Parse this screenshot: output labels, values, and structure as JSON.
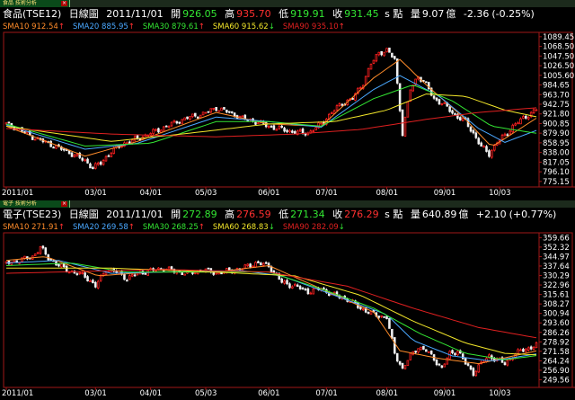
{
  "colors": {
    "up": "#ff2020",
    "down": "#f0f0f0",
    "axis_frame": "#a01818",
    "axis_text": "#ffffff",
    "sma10": "#ff8c2a",
    "sma20": "#4aa8ff",
    "sma30": "#33e633",
    "sma60": "#f2e62a",
    "sma90": "#e02020"
  },
  "panels": [
    {
      "tab_label": "食品 技術分析",
      "info": {
        "name": "食品(TSE12)",
        "period": "日線圖",
        "date": "2011/11/01",
        "open_label": "開",
        "open": "926.05",
        "high_label": "高",
        "high": "935.70",
        "low_label": "低",
        "low": "919.91",
        "close_label": "收",
        "close": "931.45",
        "unit": "s 點",
        "volume_label": "量",
        "volume": "9.07",
        "volume_unit": "億",
        "change": "-2.36",
        "change_pct": "(-0.25%)"
      },
      "ma_legend": [
        {
          "label": "SMA10",
          "value": "912.54",
          "arrow": "↑",
          "color": "#ff8c2a"
        },
        {
          "label": "SMA20",
          "value": "885.95",
          "arrow": "↑",
          "color": "#4aa8ff"
        },
        {
          "label": "SMA30",
          "value": "879.61",
          "arrow": "↑",
          "color": "#33e633"
        },
        {
          "label": "SMA60",
          "value": "915.62",
          "arrow": "↓",
          "color": "#f2e62a"
        },
        {
          "label": "SMA90",
          "value": "935.10",
          "arrow": "↑",
          "color": "#e02020"
        }
      ]
    },
    {
      "tab_label": "電子 技術分析",
      "info": {
        "name": "電子(TSE23)",
        "period": "日線圖",
        "date": "2011/11/01",
        "open_label": "開",
        "open": "272.89",
        "high_label": "高",
        "high": "276.59",
        "low_label": "低",
        "low": "271.34",
        "close_label": "收",
        "close": "276.29",
        "unit": "s 點",
        "volume_label": "量",
        "volume": "640.89",
        "volume_unit": "億",
        "change": "+2.10",
        "change_pct": "(+0.77%)"
      },
      "ma_legend": [
        {
          "label": "SMA10",
          "value": "271.91",
          "arrow": "↑",
          "color": "#ff8c2a"
        },
        {
          "label": "SMA20",
          "value": "269.58",
          "arrow": "↑",
          "color": "#4aa8ff"
        },
        {
          "label": "SMA30",
          "value": "268.25",
          "arrow": "↑",
          "color": "#33e633"
        },
        {
          "label": "SMA60",
          "value": "268.83",
          "arrow": "↓",
          "color": "#f2e62a"
        },
        {
          "label": "SMA90",
          "value": "282.09",
          "arrow": "↓",
          "color": "#e02020"
        }
      ]
    }
  ],
  "chart_data": [
    {
      "type": "candlestick",
      "title": "食品(TSE12) 日線圖",
      "ylim": [
        767,
        1095
      ],
      "y_ticks": [
        "1089.45",
        "1068.50",
        "1047.50",
        "1026.50",
        "1005.60",
        "984.65",
        "963.70",
        "942.75",
        "921.80",
        "900.85",
        "879.90",
        "858.95",
        "838.00",
        "817.05",
        "796.10",
        "775.15"
      ],
      "y_tick_values": [
        1089.45,
        1068.5,
        1047.5,
        1026.5,
        1005.6,
        984.65,
        963.7,
        942.75,
        921.8,
        900.85,
        879.9,
        858.95,
        838.0,
        817.05,
        796.1,
        775.15
      ],
      "x_ticks": [
        "2011/01",
        "03/01",
        "04/01",
        "05/03",
        "06/01",
        "07/01",
        "08/01",
        "09/01",
        "10/03"
      ],
      "x_tick_index": [
        0,
        34,
        55,
        76,
        100,
        122,
        145,
        167,
        188
      ],
      "close_series": [
        [
          0,
          900
        ],
        [
          5,
          888
        ],
        [
          10,
          872
        ],
        [
          15,
          860
        ],
        [
          20,
          848
        ],
        [
          25,
          835
        ],
        [
          30,
          820
        ],
        [
          33,
          805
        ],
        [
          36,
          815
        ],
        [
          40,
          840
        ],
        [
          45,
          858
        ],
        [
          50,
          868
        ],
        [
          55,
          880
        ],
        [
          60,
          892
        ],
        [
          65,
          905
        ],
        [
          70,
          915
        ],
        [
          75,
          922
        ],
        [
          80,
          935
        ],
        [
          85,
          925
        ],
        [
          90,
          912
        ],
        [
          95,
          905
        ],
        [
          100,
          895
        ],
        [
          105,
          888
        ],
        [
          110,
          882
        ],
        [
          115,
          880
        ],
        [
          120,
          900
        ],
        [
          124,
          925
        ],
        [
          128,
          945
        ],
        [
          132,
          955
        ],
        [
          136,
          990
        ],
        [
          139,
          1030
        ],
        [
          142,
          1055
        ],
        [
          145,
          1060
        ],
        [
          148,
          1040
        ],
        [
          151,
          880
        ],
        [
          154,
          975
        ],
        [
          157,
          1005
        ],
        [
          160,
          985
        ],
        [
          163,
          955
        ],
        [
          166,
          945
        ],
        [
          169,
          930
        ],
        [
          172,
          915
        ],
        [
          175,
          905
        ],
        [
          178,
          880
        ],
        [
          181,
          850
        ],
        [
          184,
          835
        ],
        [
          187,
          860
        ],
        [
          190,
          875
        ],
        [
          193,
          895
        ],
        [
          196,
          908
        ],
        [
          199,
          920
        ],
        [
          202,
          931.45
        ]
      ],
      "sma_series": [
        {
          "name": "SMA10",
          "points": [
            [
              0,
              895
            ],
            [
              30,
              830
            ],
            [
              50,
              862
            ],
            [
              80,
              925
            ],
            [
              100,
              900
            ],
            [
              120,
              895
            ],
            [
              140,
              1000
            ],
            [
              150,
              1040
            ],
            [
              160,
              985
            ],
            [
              175,
              910
            ],
            [
              185,
              850
            ],
            [
              202,
              912.54
            ]
          ]
        },
        {
          "name": "SMA20",
          "points": [
            [
              0,
              898
            ],
            [
              30,
              845
            ],
            [
              50,
              858
            ],
            [
              80,
              915
            ],
            [
              100,
              905
            ],
            [
              120,
              893
            ],
            [
              140,
              975
            ],
            [
              150,
              1005
            ],
            [
              165,
              960
            ],
            [
              180,
              890
            ],
            [
              190,
              860
            ],
            [
              202,
              885.95
            ]
          ]
        },
        {
          "name": "SMA30",
          "points": [
            [
              0,
              900
            ],
            [
              30,
              852
            ],
            [
              55,
              858
            ],
            [
              80,
              905
            ],
            [
              100,
              905
            ],
            [
              120,
              895
            ],
            [
              140,
              955
            ],
            [
              155,
              985
            ],
            [
              170,
              950
            ],
            [
              185,
              895
            ],
            [
              202,
              879.61
            ]
          ]
        },
        {
          "name": "SMA60",
          "points": [
            [
              0,
              895
            ],
            [
              40,
              862
            ],
            [
              70,
              880
            ],
            [
              100,
              900
            ],
            [
              125,
              905
            ],
            [
              145,
              930
            ],
            [
              160,
              965
            ],
            [
              175,
              960
            ],
            [
              190,
              930
            ],
            [
              202,
              915.62
            ]
          ]
        },
        {
          "name": "SMA90",
          "points": [
            [
              0,
              890
            ],
            [
              40,
              878
            ],
            [
              80,
              872
            ],
            [
              110,
              878
            ],
            [
              135,
              888
            ],
            [
              160,
              910
            ],
            [
              180,
              925
            ],
            [
              202,
              935.1
            ]
          ]
        }
      ]
    },
    {
      "type": "candlestick",
      "title": "電子(TSE23) 日線圖",
      "ylim": [
        245,
        362
      ],
      "y_ticks": [
        "359.66",
        "352.32",
        "344.97",
        "337.64",
        "330.29",
        "322.96",
        "315.61",
        "308.27",
        "300.94",
        "293.60",
        "286.26",
        "278.92",
        "271.58",
        "264.24",
        "256.90",
        "249.56"
      ],
      "y_tick_values": [
        359.66,
        352.32,
        344.97,
        337.64,
        330.29,
        322.96,
        315.61,
        308.27,
        300.94,
        293.6,
        286.26,
        278.92,
        271.58,
        264.24,
        256.9,
        249.56
      ],
      "x_ticks": [
        "2011/01",
        "03/01",
        "04/01",
        "05/03",
        "06/01",
        "07/01",
        "08/01",
        "09/01",
        "10/03"
      ],
      "x_tick_index": [
        0,
        34,
        55,
        76,
        100,
        122,
        145,
        167,
        188
      ],
      "close_series": [
        [
          0,
          340
        ],
        [
          5,
          342
        ],
        [
          10,
          345
        ],
        [
          13,
          352
        ],
        [
          16,
          344
        ],
        [
          20,
          338
        ],
        [
          25,
          333
        ],
        [
          30,
          330
        ],
        [
          34,
          322
        ],
        [
          38,
          335
        ],
        [
          42,
          333
        ],
        [
          46,
          328
        ],
        [
          50,
          332
        ],
        [
          55,
          334
        ],
        [
          60,
          336
        ],
        [
          65,
          333
        ],
        [
          70,
          332
        ],
        [
          75,
          335
        ],
        [
          80,
          332
        ],
        [
          85,
          334
        ],
        [
          90,
          336
        ],
        [
          95,
          340
        ],
        [
          100,
          338
        ],
        [
          105,
          325
        ],
        [
          110,
          322
        ],
        [
          115,
          318
        ],
        [
          120,
          320
        ],
        [
          125,
          315
        ],
        [
          130,
          312
        ],
        [
          135,
          305
        ],
        [
          140,
          300
        ],
        [
          145,
          298
        ],
        [
          148,
          270
        ],
        [
          151,
          258
        ],
        [
          154,
          268
        ],
        [
          157,
          275
        ],
        [
          160,
          272
        ],
        [
          163,
          266
        ],
        [
          166,
          258
        ],
        [
          169,
          270
        ],
        [
          172,
          272
        ],
        [
          175,
          262
        ],
        [
          178,
          255
        ],
        [
          181,
          262
        ],
        [
          184,
          268
        ],
        [
          187,
          265
        ],
        [
          190,
          262
        ],
        [
          193,
          268
        ],
        [
          196,
          272
        ],
        [
          199,
          274
        ],
        [
          202,
          276.29
        ]
      ],
      "sma_series": [
        {
          "name": "SMA10",
          "points": [
            [
              0,
              342
            ],
            [
              15,
              345
            ],
            [
              35,
              330
            ],
            [
              55,
              333
            ],
            [
              80,
              333
            ],
            [
              100,
              338
            ],
            [
              120,
              320
            ],
            [
              140,
              302
            ],
            [
              150,
              272
            ],
            [
              165,
              266
            ],
            [
              180,
              262
            ],
            [
              202,
              271.91
            ]
          ]
        },
        {
          "name": "SMA20",
          "points": [
            [
              0,
              340
            ],
            [
              20,
              342
            ],
            [
              40,
              332
            ],
            [
              60,
              333
            ],
            [
              90,
              334
            ],
            [
              105,
              330
            ],
            [
              125,
              315
            ],
            [
              145,
              300
            ],
            [
              155,
              280
            ],
            [
              170,
              268
            ],
            [
              185,
              264
            ],
            [
              202,
              269.58
            ]
          ]
        },
        {
          "name": "SMA30",
          "points": [
            [
              0,
              338
            ],
            [
              25,
              340
            ],
            [
              45,
              333
            ],
            [
              70,
              333
            ],
            [
              100,
              333
            ],
            [
              120,
              320
            ],
            [
              140,
              305
            ],
            [
              158,
              285
            ],
            [
              175,
              270
            ],
            [
              190,
              265
            ],
            [
              202,
              268.25
            ]
          ]
        },
        {
          "name": "SMA60",
          "points": [
            [
              0,
              336
            ],
            [
              40,
              336
            ],
            [
              80,
              333
            ],
            [
              110,
              330
            ],
            [
              135,
              315
            ],
            [
              155,
              295
            ],
            [
              175,
              278
            ],
            [
              190,
              270
            ],
            [
              202,
              268.83
            ]
          ]
        },
        {
          "name": "SMA90",
          "points": [
            [
              0,
              332
            ],
            [
              60,
              335
            ],
            [
              100,
              333
            ],
            [
              130,
              322
            ],
            [
              155,
              305
            ],
            [
              180,
              290
            ],
            [
              202,
              282.09
            ]
          ]
        }
      ]
    }
  ]
}
